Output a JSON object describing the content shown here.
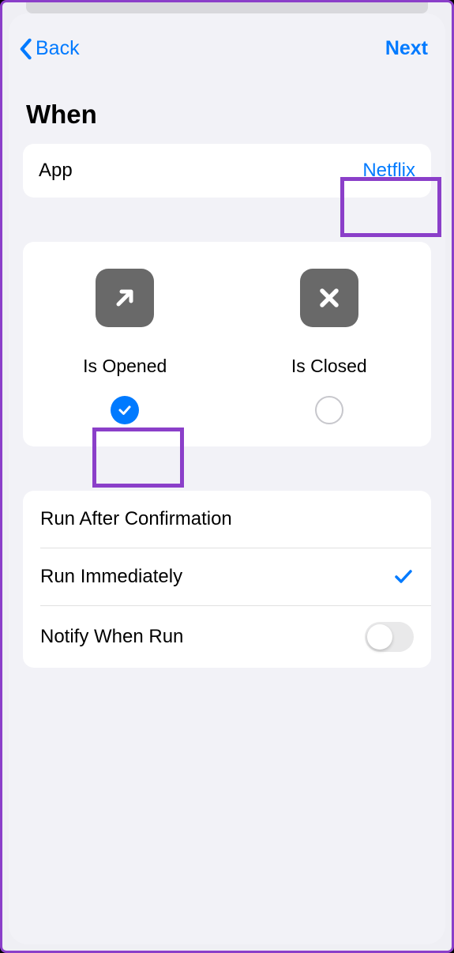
{
  "nav": {
    "back_label": "Back",
    "next_label": "Next"
  },
  "title": "When",
  "app_row": {
    "label": "App",
    "value": "Netflix"
  },
  "options": {
    "opened_label": "Is Opened",
    "closed_label": "Is Closed",
    "selected": "opened"
  },
  "settings": {
    "confirm_label": "Run After Confirmation",
    "immediate_label": "Run Immediately",
    "notify_label": "Notify When Run",
    "selected_mode": "immediate",
    "notify_enabled": false
  }
}
